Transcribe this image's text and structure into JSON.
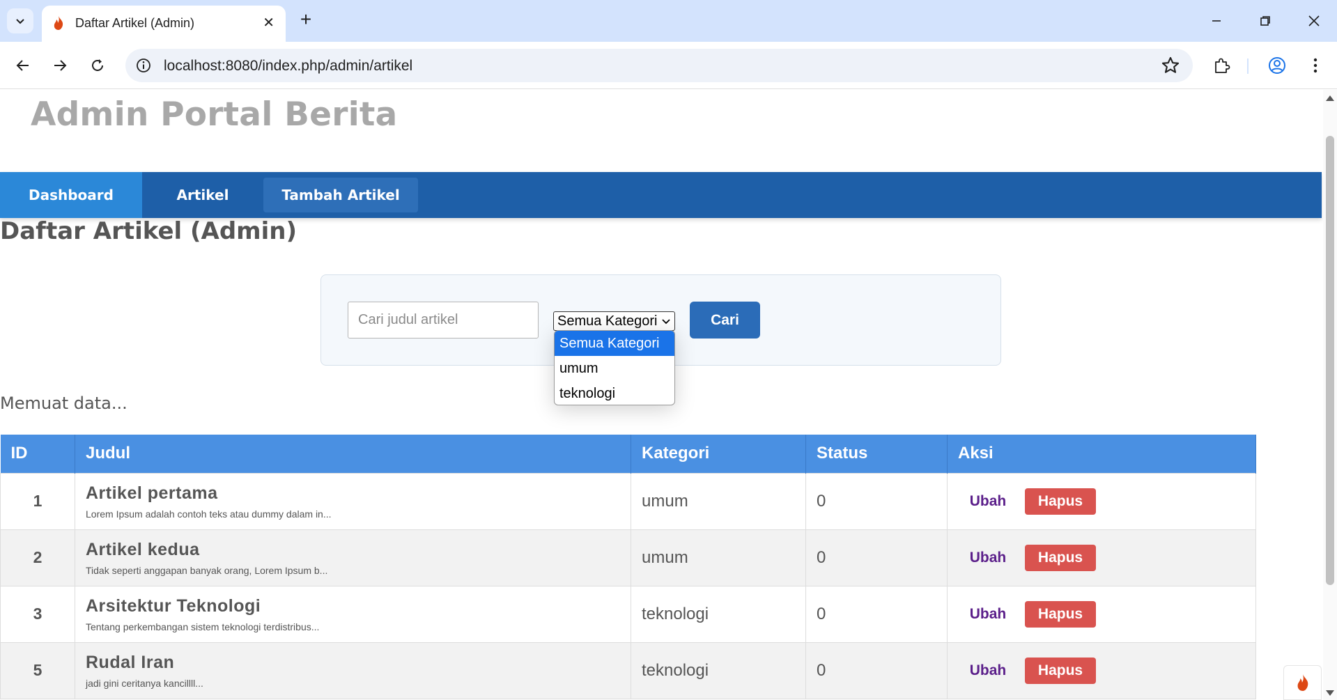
{
  "browser": {
    "tab_title": "Daftar Artikel (Admin)",
    "url": "localhost:8080/index.php/admin/artikel"
  },
  "site": {
    "title": "Admin Portal Berita"
  },
  "nav": {
    "items": [
      {
        "label": "Dashboard"
      },
      {
        "label": "Artikel"
      },
      {
        "label": "Tambah Artikel"
      }
    ]
  },
  "page": {
    "heading": "Daftar Artikel (Admin)",
    "loading_text": "Memuat data..."
  },
  "filter": {
    "search_placeholder": "Cari judul artikel",
    "search_value": "",
    "category_selected": "Semua Kategori",
    "category_options": [
      "Semua Kategori",
      "umum",
      "teknologi"
    ],
    "submit_label": "Cari"
  },
  "table": {
    "columns": [
      "ID",
      "Judul",
      "Kategori",
      "Status",
      "Aksi"
    ],
    "rows": [
      {
        "id": "1",
        "title": "Artikel pertama",
        "excerpt": "Lorem Ipsum adalah contoh teks atau dummy dalam in...",
        "category": "umum",
        "status": "0",
        "edit_label": "Ubah",
        "delete_label": "Hapus"
      },
      {
        "id": "2",
        "title": "Artikel kedua",
        "excerpt": "Tidak seperti anggapan banyak orang, Lorem Ipsum b...",
        "category": "umum",
        "status": "0",
        "edit_label": "Ubah",
        "delete_label": "Hapus"
      },
      {
        "id": "3",
        "title": "Arsitektur Teknologi",
        "excerpt": "Tentang perkembangan sistem teknologi terdistribus...",
        "category": "teknologi",
        "status": "0",
        "edit_label": "Ubah",
        "delete_label": "Hapus"
      },
      {
        "id": "5",
        "title": "Rudal Iran",
        "excerpt": "jadi gini ceritanya kancillll...",
        "category": "teknologi",
        "status": "0",
        "edit_label": "Ubah",
        "delete_label": "Hapus"
      }
    ]
  },
  "colors": {
    "navbar": "#1e5fa8",
    "nav_active": "#2b88d8",
    "table_header": "#4a90e2",
    "delete_button": "#d9534f",
    "edit_link": "#5b1f8a",
    "dropdown_selected": "#1a73e8"
  },
  "icons": {
    "tab_favicon": "codeigniter-flame-icon",
    "debug_toolbar": "codeigniter-flame-icon"
  }
}
